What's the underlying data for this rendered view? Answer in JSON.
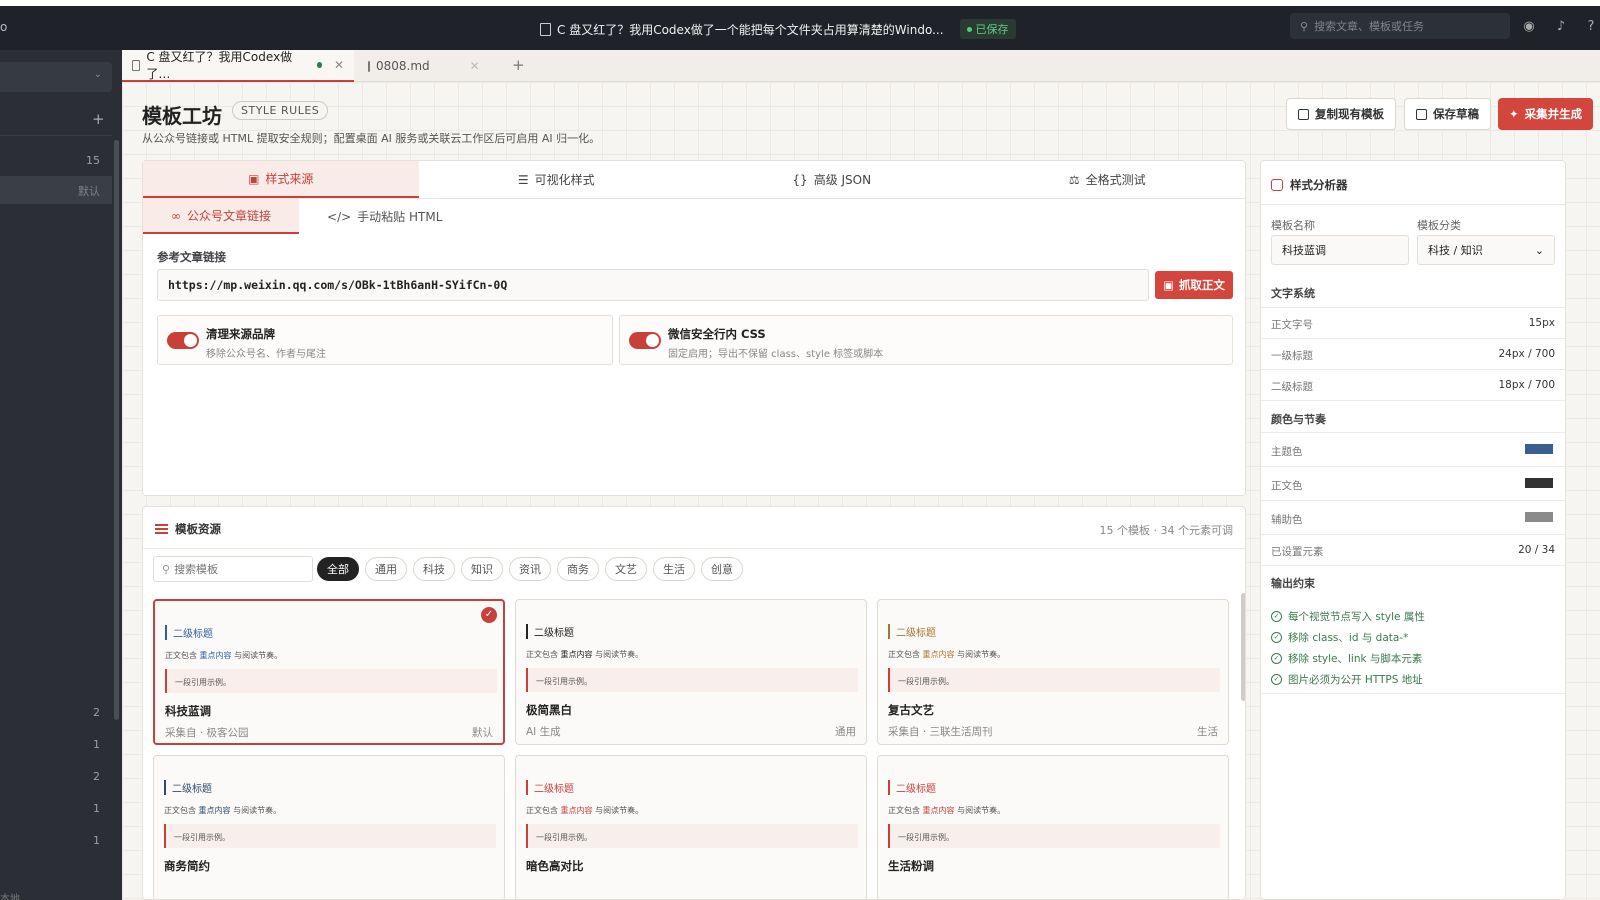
{
  "window": {
    "left_text": "o",
    "doc_title": "C 盘又红了？我用Codex做了一个能把每个文件夹占用算清楚的Windo...",
    "saved": "已保存",
    "search_placeholder": "搜索文章、模板或任务"
  },
  "sidebar": {
    "counts": [
      "15"
    ],
    "default_label": "默认",
    "item_counts": [
      "2",
      "1",
      "2",
      "1",
      "1"
    ],
    "footer": "本地"
  },
  "file_tabs": [
    {
      "label": "C 盘又红了？我用Codex做了…",
      "active": true
    },
    {
      "label": "0808.md",
      "active": false
    }
  ],
  "page": {
    "title": "模板工坊",
    "badge": "STYLE RULES",
    "subtitle": "从公众号链接或 HTML 提取安全规则；配置桌面 AI 服务或关联云工作区后可启用 AI 归一化。",
    "buttons": {
      "copy": "复制现有模板",
      "save": "保存草稿",
      "generate": "采集并生成"
    }
  },
  "source": {
    "tabs": [
      "样式来源",
      "可视化样式",
      "高级 JSON",
      "全格式测试"
    ],
    "subtabs": [
      "公众号文章链接",
      "手动粘贴 HTML"
    ],
    "url_label": "参考文章链接",
    "url_value": "https://mp.weixin.qq.com/s/OBk-1tBh6anH-SYifCn-0Q",
    "fetch_label": "抓取正文",
    "toggles": [
      {
        "title": "清理来源品牌",
        "desc": "移除公众号名、作者与尾注"
      },
      {
        "title": "微信安全行内 CSS",
        "desc": "固定启用；导出不保留 class、style 标签或脚本"
      }
    ]
  },
  "resources": {
    "title": "模板资源",
    "count": "15 个模板 · 34 个元素可调",
    "search_placeholder": "搜索模板",
    "chips": [
      "全部",
      "通用",
      "科技",
      "知识",
      "资讯",
      "商务",
      "文艺",
      "生活",
      "创意"
    ],
    "preview": {
      "h2": "二级标题",
      "para_before": "正文包含",
      "para_hl": "重点内容",
      "para_after": "与阅读节奏。",
      "quote": "一段引用示例。"
    },
    "cards": [
      {
        "name": "科技蓝调",
        "meta": "采集自 · 极客公园",
        "tag": "默认",
        "accent": "#2f5fa8"
      },
      {
        "name": "极简黑白",
        "meta": "AI 生成",
        "tag": "通用",
        "accent": "#222222"
      },
      {
        "name": "复古文艺",
        "meta": "采集自 · 三联生活周刊",
        "tag": "生活",
        "accent": "#a8742f"
      },
      {
        "name": "商务简约",
        "meta": "",
        "tag": "",
        "accent": "#2f4a6a"
      },
      {
        "name": "暗色高对比",
        "meta": "",
        "tag": "",
        "accent": "#c9403a"
      },
      {
        "name": "生活粉调",
        "meta": "",
        "tag": "",
        "accent": "#c9403a"
      }
    ]
  },
  "analyzer": {
    "title": "样式分析器",
    "name_label": "模板名称",
    "name_value": "科技蓝调",
    "category_label": "模板分类",
    "category_value": "科技 / 知识",
    "text_system": "文字系统",
    "rows_text": [
      {
        "k": "正文字号",
        "v": "15px"
      },
      {
        "k": "一级标题",
        "v": "24px / 700"
      },
      {
        "k": "二级标题",
        "v": "18px / 700"
      }
    ],
    "color_rhythm": "颜色与节奏",
    "rows_color": [
      {
        "k": "主题色",
        "color": "#3a5f8f"
      },
      {
        "k": "正文色",
        "color": "#333333"
      },
      {
        "k": "辅助色",
        "color": "#8a8a8a"
      }
    ],
    "set_elements_label": "已设置元素",
    "set_elements_value": "20 / 34",
    "output_label": "输出约束",
    "constraints": [
      "每个视觉节点写入 style 属性",
      "移除 class、id 与 data-*",
      "移除 style、link 与脚本元素",
      "图片必须为公开 HTTPS 地址"
    ]
  },
  "colors": {
    "accent": "#c9403a",
    "titlebar": "#1f2228",
    "sidebar": "#2b2e35",
    "saved_green": "#4cd07d"
  }
}
